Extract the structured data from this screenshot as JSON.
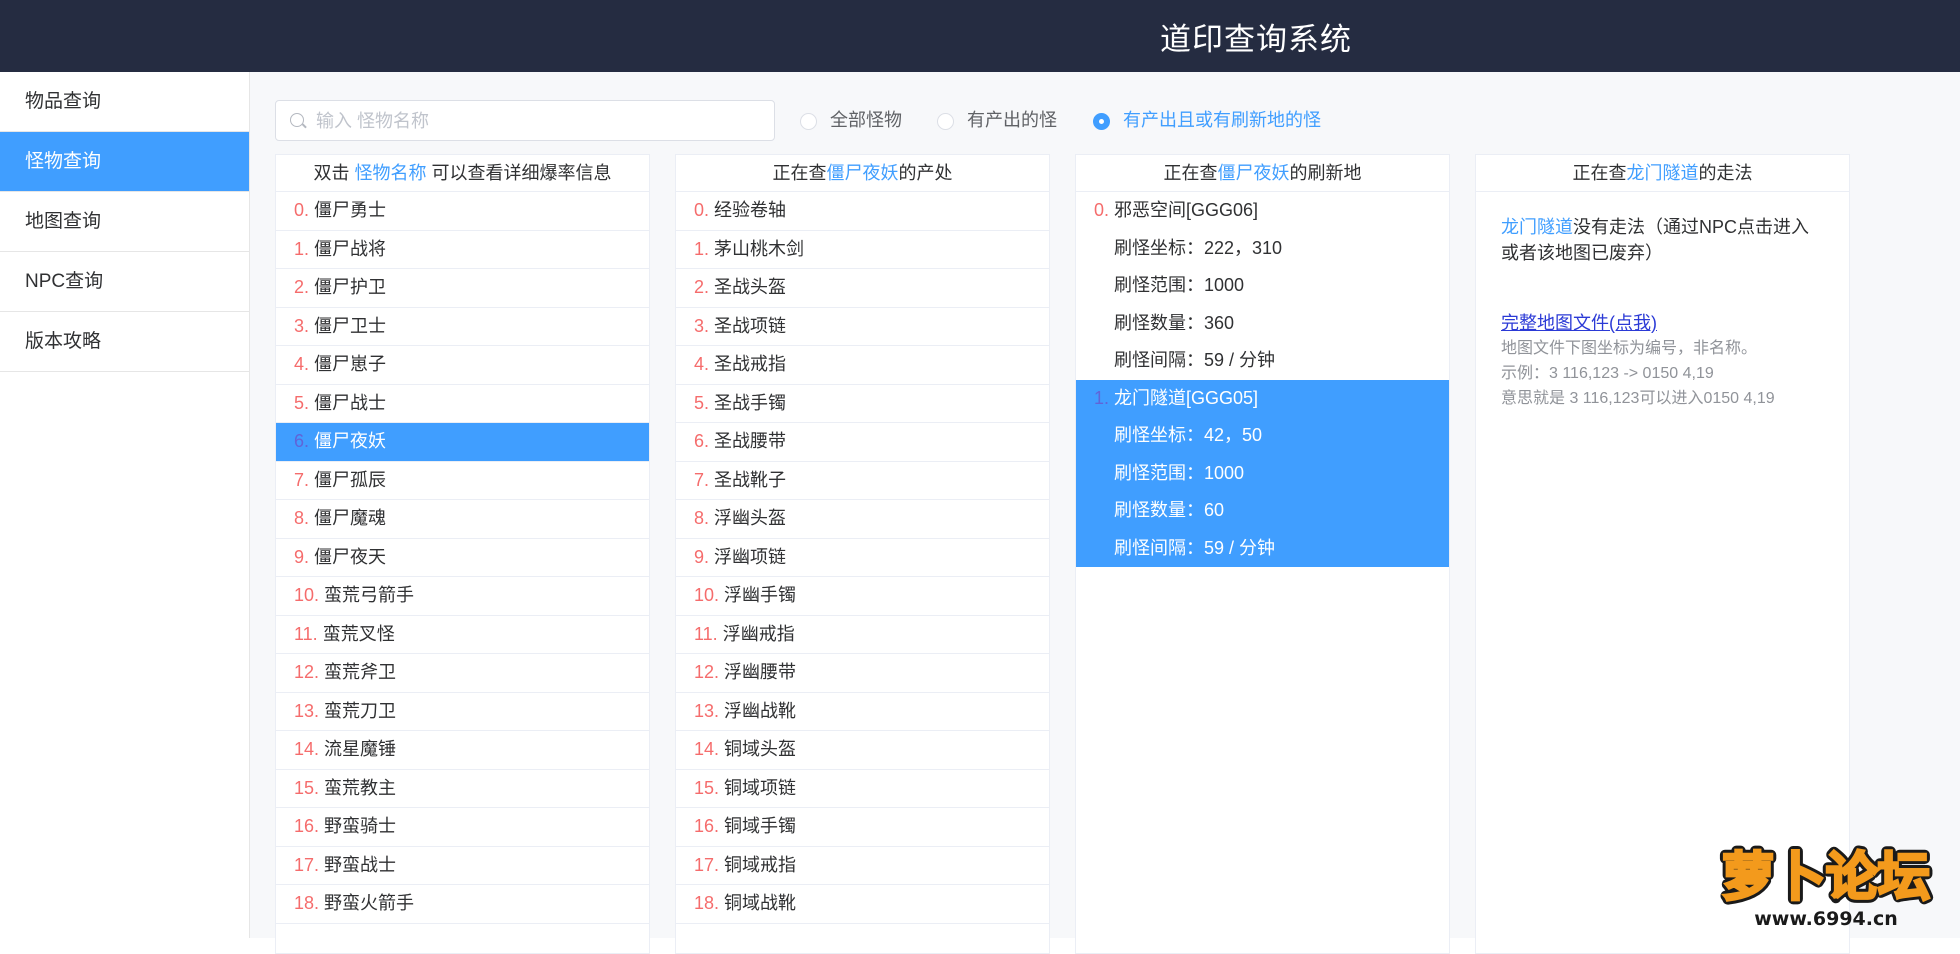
{
  "app": {
    "title": "道印查询系统"
  },
  "sidebar": {
    "items": [
      {
        "label": "物品查询"
      },
      {
        "label": "怪物查询"
      },
      {
        "label": "地图查询"
      },
      {
        "label": "NPC查询"
      },
      {
        "label": "版本攻略"
      }
    ]
  },
  "search": {
    "placeholder": "输入 怪物名称",
    "value": ""
  },
  "filters": {
    "options": [
      "全部怪物",
      "有产出的怪",
      "有产出且或有刷新地的怪"
    ],
    "selected": "有产出且或有刷新地的怪"
  },
  "monster_panel": {
    "header_prefix": "双击 ",
    "header_highlight": "怪物名称",
    "header_suffix": " 可以查看详细爆率信息",
    "selected_index": 6,
    "items": [
      {
        "index": "0.",
        "name": "僵尸勇士"
      },
      {
        "index": "1.",
        "name": "僵尸战将"
      },
      {
        "index": "2.",
        "name": "僵尸护卫"
      },
      {
        "index": "3.",
        "name": "僵尸卫士"
      },
      {
        "index": "4.",
        "name": "僵尸崽子"
      },
      {
        "index": "5.",
        "name": "僵尸战士"
      },
      {
        "index": "6.",
        "name": "僵尸夜妖"
      },
      {
        "index": "7.",
        "name": "僵尸孤辰"
      },
      {
        "index": "8.",
        "name": "僵尸魔魂"
      },
      {
        "index": "9.",
        "name": "僵尸夜天"
      },
      {
        "index": "10.",
        "name": "蛮荒弓箭手"
      },
      {
        "index": "11.",
        "name": "蛮荒叉怪"
      },
      {
        "index": "12.",
        "name": "蛮荒斧卫"
      },
      {
        "index": "13.",
        "name": "蛮荒刀卫"
      },
      {
        "index": "14.",
        "name": "流星魔锤"
      },
      {
        "index": "15.",
        "name": "蛮荒教主"
      },
      {
        "index": "16.",
        "name": "野蛮骑士"
      },
      {
        "index": "17.",
        "name": "野蛮战士"
      },
      {
        "index": "18.",
        "name": "野蛮火箭手"
      }
    ]
  },
  "drops_panel": {
    "header_prefix": "正在查",
    "header_highlight": "僵尸夜妖",
    "header_suffix": "的产处",
    "items": [
      {
        "index": "0.",
        "name": "经验卷轴"
      },
      {
        "index": "1.",
        "name": "茅山桃木剑"
      },
      {
        "index": "2.",
        "name": "圣战头盔"
      },
      {
        "index": "3.",
        "name": "圣战项链"
      },
      {
        "index": "4.",
        "name": "圣战戒指"
      },
      {
        "index": "5.",
        "name": "圣战手镯"
      },
      {
        "index": "6.",
        "name": "圣战腰带"
      },
      {
        "index": "7.",
        "name": "圣战靴子"
      },
      {
        "index": "8.",
        "name": "浮幽头盔"
      },
      {
        "index": "9.",
        "name": "浮幽项链"
      },
      {
        "index": "10.",
        "name": "浮幽手镯"
      },
      {
        "index": "11.",
        "name": "浮幽戒指"
      },
      {
        "index": "12.",
        "name": "浮幽腰带"
      },
      {
        "index": "13.",
        "name": "浮幽战靴"
      },
      {
        "index": "14.",
        "name": "铜域头盔"
      },
      {
        "index": "15.",
        "name": "铜域项链"
      },
      {
        "index": "16.",
        "name": "铜域手镯"
      },
      {
        "index": "17.",
        "name": "铜域戒指"
      },
      {
        "index": "18.",
        "name": "铜域战靴"
      }
    ]
  },
  "spawn_panel": {
    "header_prefix": "正在查",
    "header_highlight": "僵尸夜妖",
    "header_suffix": "的刷新地",
    "selected_index": 1,
    "items": [
      {
        "index": "0.",
        "map": "邪恶空间[GGG06]",
        "coord": "刷怪坐标：222，310",
        "range": "刷怪范围：1000",
        "count": "刷怪数量：360",
        "interval": "刷怪间隔：59 / 分钟"
      },
      {
        "index": "1.",
        "map": "龙门隧道[GGG05]",
        "coord": "刷怪坐标：42，50",
        "range": "刷怪范围：1000",
        "count": "刷怪数量：60",
        "interval": "刷怪间隔：59 / 分钟"
      }
    ]
  },
  "route_panel": {
    "header_prefix": "正在查",
    "header_highlight": "龙门隧道",
    "header_suffix": "的走法",
    "message_highlight": "龙门隧道",
    "message_text": "没有走法（通过NPC点击进入或者该地图已废弃）",
    "link_label": "完整地图文件(点我)",
    "note_1": "地图文件下图坐标为编号，非名称。",
    "note_2": "示例：3 116,123 -> 0150 4,19",
    "note_3": "意思就是 3 116,123可以进入0150 4,19"
  },
  "watermark": {
    "brand": "萝卜论坛",
    "url": "www.6994.cn"
  },
  "colors": {
    "header_bg": "#252c41",
    "accent": "#409eff",
    "index_red": "#f56c6c",
    "link": "#2b3ad6"
  }
}
